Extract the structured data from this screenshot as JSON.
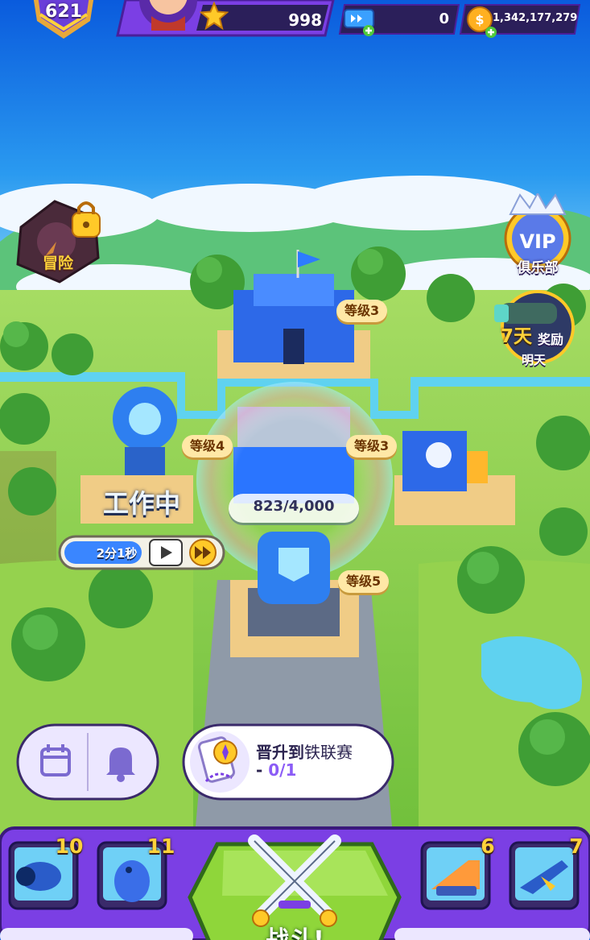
{
  "hud": {
    "trophies": "621",
    "stars": "998",
    "tickets": "0",
    "coins": "1,342,177,279"
  },
  "side": {
    "adventure_label": "冒险",
    "vip_label": "VIP",
    "vip_club_label": "俱乐部",
    "reward_days": "7天",
    "reward_label": "奖励",
    "reward_when": "明天"
  },
  "buildings": {
    "hq_level": "等级3",
    "lab_level": "等级4",
    "factory_level": "等级3",
    "cannon_level": "等级5",
    "lab_status": "工作中",
    "lab_timer": "2分1秒",
    "troops": "823/4,000"
  },
  "promo": {
    "line1_prefix": "晋升到",
    "line1_league": "铁联赛",
    "line2_prefix": "- ",
    "line2_progress": "0/1"
  },
  "cards": [
    {
      "name": "cannon",
      "count": "10"
    },
    {
      "name": "penguin",
      "count": "11"
    },
    {
      "name": "ramp",
      "count": "6"
    },
    {
      "name": "jet",
      "count": "7"
    }
  ],
  "battle_label": "战斗!",
  "colors": {
    "sky": "#0f63e0",
    "grass": "#7cc84a",
    "purple_ui": "#7b3fe4",
    "gold": "#ffd23a",
    "battle_green": "#8fd63a"
  },
  "icons": [
    "trophy-icon",
    "avatar-icon",
    "star-icon",
    "ticket-icon",
    "coin-icon",
    "lock-icon",
    "crown-icon",
    "calendar-icon",
    "bell-icon",
    "compass-icon",
    "crossed-swords-icon",
    "video-icon",
    "fast-forward-icon"
  ]
}
